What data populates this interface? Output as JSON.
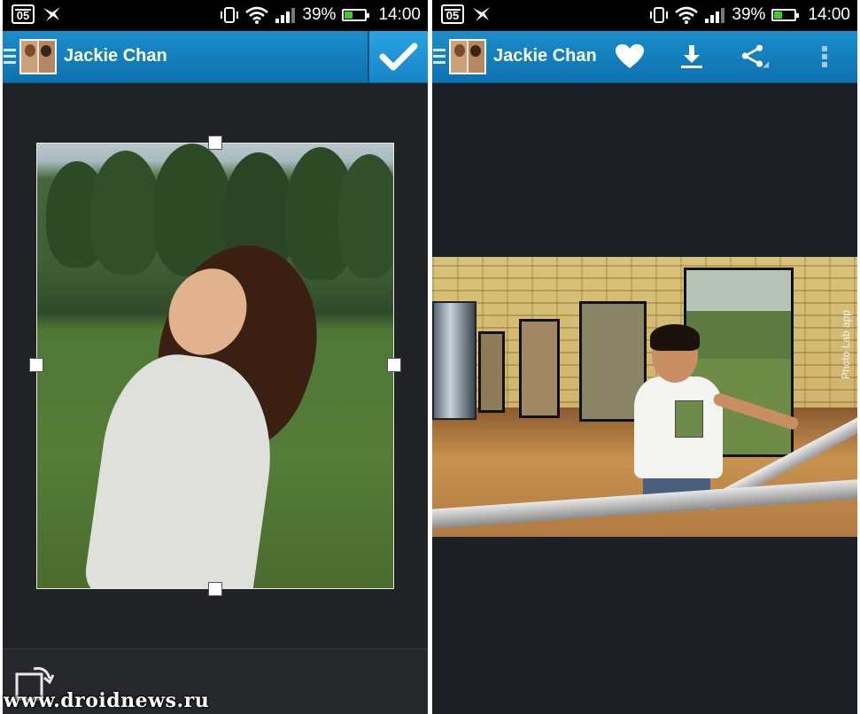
{
  "status_bar": {
    "date_badge": "05",
    "battery_percent": "39%",
    "time": "14:00",
    "battery_level": 0.39
  },
  "left_screen": {
    "title": "Jackie Chan",
    "confirm_icon": "checkmark-icon",
    "rotate_icon": "rotate-icon"
  },
  "right_screen": {
    "title": "Jackie Chan",
    "actions": [
      "heart-icon",
      "download-icon",
      "share-icon",
      "more-vert-icon"
    ],
    "image_watermark": "Photo Lab app"
  },
  "colors": {
    "app_bar": "#1488c6",
    "background": "#1f2124"
  },
  "site_watermark": "www.droidnews.ru"
}
